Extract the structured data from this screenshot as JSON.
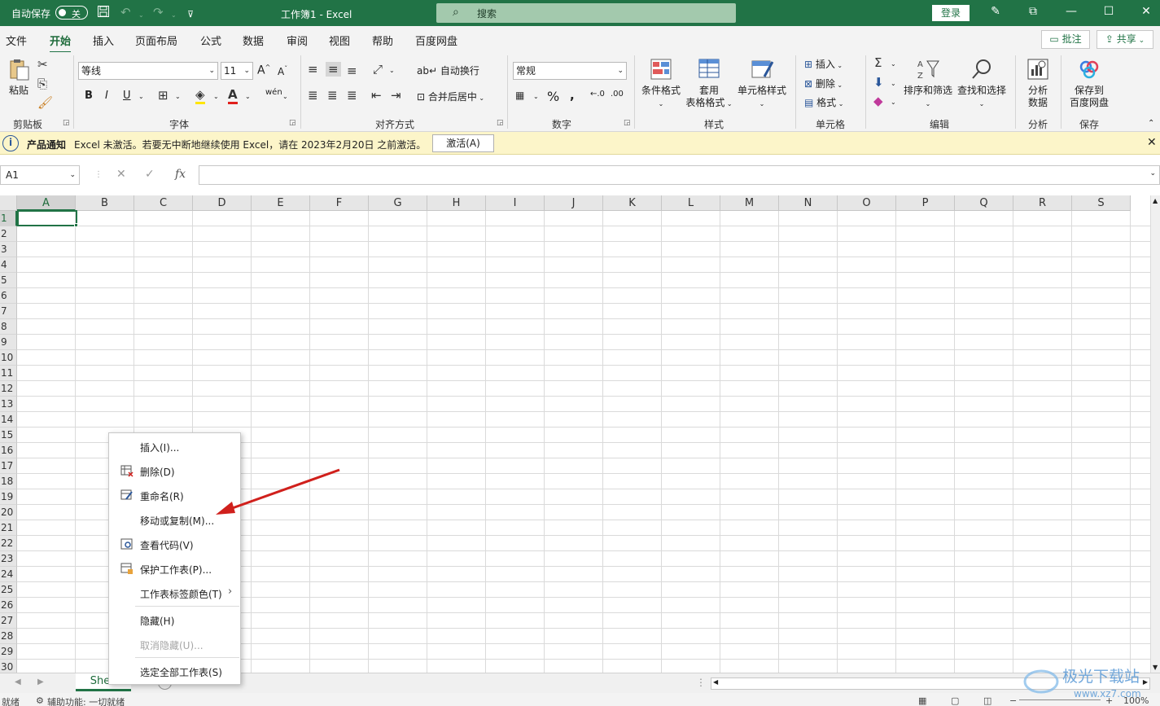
{
  "titlebar": {
    "autosave_label": "自动保存",
    "autosave_state": "关",
    "title": "工作簿1  -  Excel",
    "search_placeholder": "搜索",
    "login_label": "登录"
  },
  "menu": {
    "items": [
      "文件",
      "开始",
      "插入",
      "页面布局",
      "公式",
      "数据",
      "审阅",
      "视图",
      "帮助",
      "百度网盘"
    ],
    "active": "开始",
    "comments_label": "批注",
    "share_label": "共享"
  },
  "ribbon": {
    "clipboard": {
      "paste": "粘贴",
      "group": "剪贴板"
    },
    "font": {
      "name": "等线",
      "size": "11",
      "group": "字体",
      "bold": "B",
      "italic": "I",
      "underline": "U"
    },
    "alignment": {
      "wrap": "自动换行",
      "merge": "合并后居中",
      "group": "对齐方式"
    },
    "number": {
      "format": "常规",
      "group": "数字",
      "percent": "%"
    },
    "styles": {
      "conditional": "条件格式",
      "table_line1": "套用",
      "table_line2": "表格格式",
      "cell_styles": "单元格样式",
      "group": "样式"
    },
    "cells": {
      "insert": "插入",
      "delete": "删除",
      "format": "格式",
      "group": "单元格"
    },
    "editing": {
      "sort": "排序和筛选",
      "find": "查找和选择",
      "group": "编辑"
    },
    "analysis": {
      "line1": "分析",
      "line2": "数据",
      "group": "分析"
    },
    "save": {
      "line1": "保存到",
      "line2": "百度网盘",
      "group": "保存"
    }
  },
  "notice": {
    "title": "产品通知",
    "message": "Excel 未激活。若要无中断地继续使用 Excel，请在 2023年2月20日 之前激活。",
    "button": "激活(A)"
  },
  "formula_bar": {
    "name_box": "A1",
    "fx_label": "fx",
    "content": ""
  },
  "grid": {
    "columns": [
      "A",
      "B",
      "C",
      "D",
      "E",
      "F",
      "G",
      "H",
      "I",
      "J",
      "K",
      "L",
      "M",
      "N",
      "O",
      "P",
      "Q",
      "R",
      "S"
    ],
    "rows": [
      "1",
      "2",
      "3",
      "4",
      "5",
      "6",
      "7",
      "8",
      "9",
      "10",
      "11",
      "12",
      "13",
      "14",
      "15",
      "16",
      "17",
      "18",
      "19",
      "20",
      "21",
      "22",
      "23",
      "24",
      "25",
      "26",
      "27",
      "28",
      "29",
      "30"
    ],
    "selected_cell": "A1"
  },
  "context_menu": {
    "items": [
      {
        "label": "插入(I)...",
        "icon": "none",
        "disabled": false
      },
      {
        "label": "删除(D)",
        "icon": "delete-sheet-icon",
        "disabled": false
      },
      {
        "label": "重命名(R)",
        "icon": "rename-icon",
        "disabled": false
      },
      {
        "label": "移动或复制(M)...",
        "icon": "none",
        "disabled": false
      },
      {
        "label": "查看代码(V)",
        "icon": "view-code-icon",
        "disabled": false
      },
      {
        "label": "保护工作表(P)...",
        "icon": "protect-sheet-icon",
        "disabled": false
      },
      {
        "label": "工作表标签颜色(T)",
        "icon": "none",
        "disabled": false,
        "submenu": true
      },
      {
        "label": "隐藏(H)",
        "icon": "none",
        "disabled": false
      },
      {
        "label": "取消隐藏(U)...",
        "icon": "none",
        "disabled": true
      },
      {
        "label": "选定全部工作表(S)",
        "icon": "none",
        "disabled": false
      }
    ]
  },
  "sheet_tabs": {
    "tabs": [
      "Sheet1"
    ],
    "visible_tab_text": "Shee"
  },
  "statusbar": {
    "ready": "就绪",
    "accessibility": "辅助功能: 一切就绪",
    "zoom": "100%"
  },
  "watermark": {
    "text": "极光下载站",
    "url": "www.xz7.com"
  },
  "colors": {
    "brand": "#217346",
    "notice_bg": "#fcf5c9",
    "arrow": "#d0201c"
  }
}
